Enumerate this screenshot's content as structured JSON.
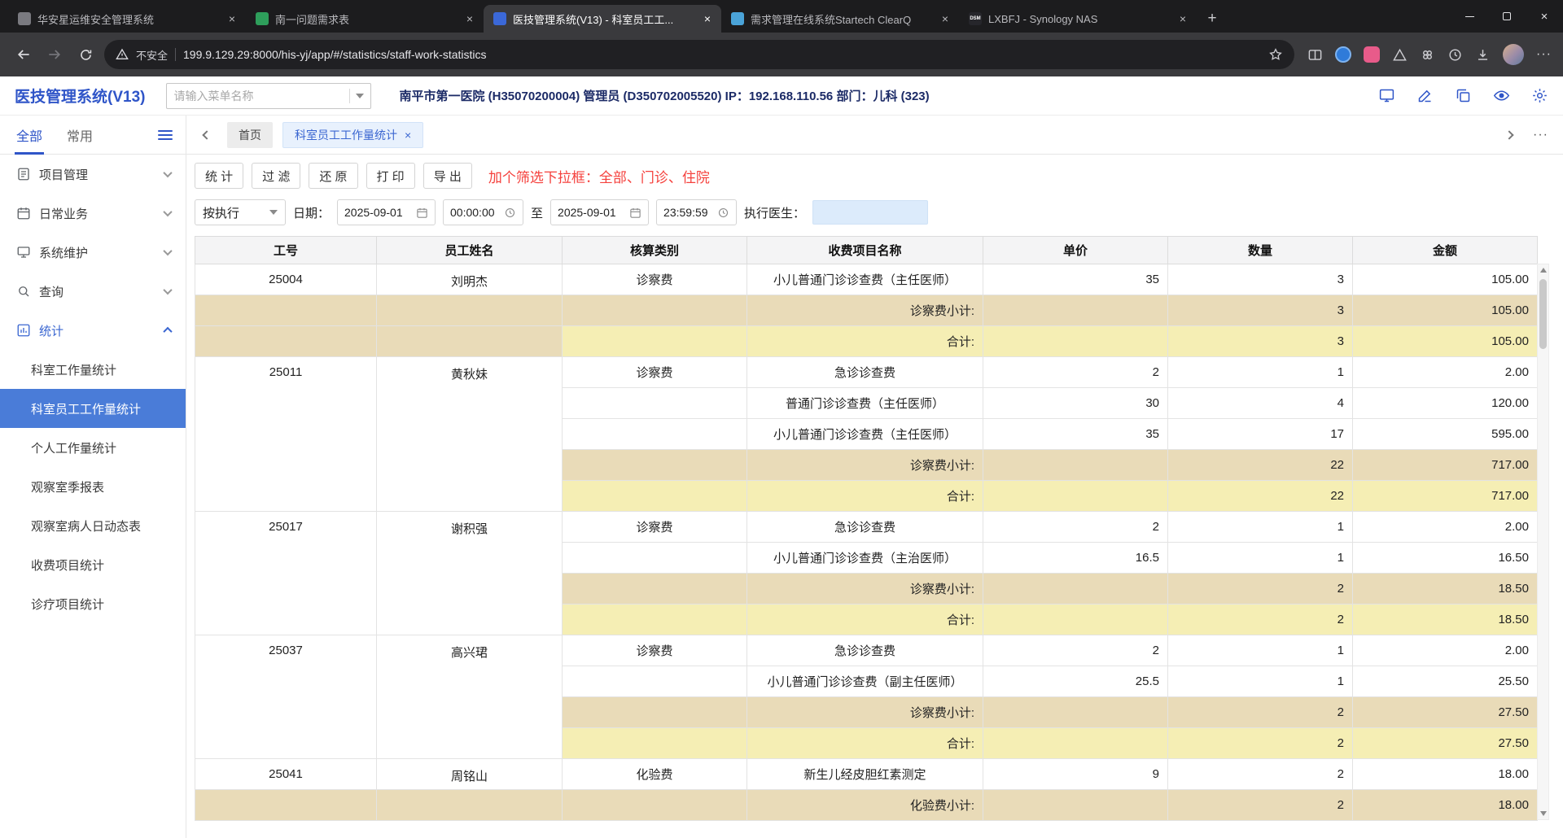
{
  "browser": {
    "tabs": [
      {
        "title": "华安星运维安全管理系统"
      },
      {
        "title": "南一问题需求表"
      },
      {
        "title": "医技管理系统(V13) - 科室员工工...",
        "active": true
      },
      {
        "title": "需求管理在线系统Startech ClearQ"
      },
      {
        "title": "LXBFJ - Synology NAS",
        "favicon_text": "DSM"
      }
    ],
    "security_label": "不安全",
    "url": "199.9.129.29:8000/his-yj/app/#/statistics/staff-work-statistics"
  },
  "header": {
    "app_title": "医技管理系统(V13)",
    "menu_search_placeholder": "请输入菜单名称",
    "user_info": "南平市第一医院 (H35070200004) 管理员 (D350702005520) IP：192.168.110.56 部门：儿科 (323)"
  },
  "tabstrip": {
    "filter_all": "全部",
    "filter_common": "常用",
    "home_tab": "首页",
    "active_tab": "科室员工工作量统计"
  },
  "sidebar": {
    "sections": [
      {
        "label": "项目管理"
      },
      {
        "label": "日常业务"
      },
      {
        "label": "系统维护"
      },
      {
        "label": "查询"
      },
      {
        "label": "统计",
        "expanded": true
      }
    ],
    "stat_children": [
      {
        "label": "科室工作量统计"
      },
      {
        "label": "科室员工工作量统计",
        "active": true
      },
      {
        "label": "个人工作量统计"
      },
      {
        "label": "观察室季报表"
      },
      {
        "label": "观察室病人日动态表"
      },
      {
        "label": "收费项目统计"
      },
      {
        "label": "诊疗项目统计"
      }
    ]
  },
  "toolbar": {
    "buttons": [
      "统 计",
      "过 滤",
      "还 原",
      "打 印",
      "导 出"
    ],
    "annotation": "加个筛选下拉框：全部、门诊、住院"
  },
  "filters": {
    "mode": "按执行",
    "date_label": "日期：",
    "date_from": "2025-09-01",
    "time_from": "00:00:00",
    "to_label": "至",
    "date_to": "2025-09-01",
    "time_to": "23:59:59",
    "doctor_label": "执行医生："
  },
  "table": {
    "columns": [
      "工号",
      "员工姓名",
      "核算类别",
      "收费项目名称",
      "单价",
      "数量",
      "金额"
    ],
    "rows": [
      {
        "type": "group",
        "span": 1,
        "id": "25004",
        "name": "刘明杰",
        "cat": "诊察费",
        "item": "小儿普通门诊诊查费（主任医师）",
        "price": "35",
        "qty": "3",
        "amount": "105.00"
      },
      {
        "type": "subfull",
        "item": "诊察费小计:",
        "qty": "3",
        "amount": "105.00"
      },
      {
        "type": "totfull",
        "item": "合计:",
        "qty": "3",
        "amount": "105.00"
      },
      {
        "type": "group",
        "span": 5,
        "id": "25011",
        "name": "黄秋妹",
        "cat": "诊察费",
        "item": "急诊诊查费",
        "price": "2",
        "qty": "1",
        "amount": "2.00"
      },
      {
        "type": "cont",
        "item": "普通门诊诊查费（主任医师）",
        "price": "30",
        "qty": "4",
        "amount": "120.00"
      },
      {
        "type": "cont",
        "item": "小儿普通门诊诊查费（主任医师）",
        "price": "35",
        "qty": "17",
        "amount": "595.00"
      },
      {
        "type": "subpart",
        "item": "诊察费小计:",
        "qty": "22",
        "amount": "717.00"
      },
      {
        "type": "totpart",
        "item": "合计:",
        "qty": "22",
        "amount": "717.00"
      },
      {
        "type": "group",
        "span": 4,
        "id": "25017",
        "name": "谢积强",
        "cat": "诊察费",
        "item": "急诊诊查费",
        "price": "2",
        "qty": "1",
        "amount": "2.00"
      },
      {
        "type": "cont",
        "item": "小儿普通门诊诊查费（主治医师）",
        "price": "16.5",
        "qty": "1",
        "amount": "16.50"
      },
      {
        "type": "subpart",
        "item": "诊察费小计:",
        "qty": "2",
        "amount": "18.50"
      },
      {
        "type": "totpart",
        "item": "合计:",
        "qty": "2",
        "amount": "18.50"
      },
      {
        "type": "group",
        "span": 4,
        "id": "25037",
        "name": "高兴珺",
        "cat": "诊察费",
        "item": "急诊诊查费",
        "price": "2",
        "qty": "1",
        "amount": "2.00"
      },
      {
        "type": "cont",
        "item": "小儿普通门诊诊查费（副主任医师）",
        "price": "25.5",
        "qty": "1",
        "amount": "25.50"
      },
      {
        "type": "subpart",
        "item": "诊察费小计:",
        "qty": "2",
        "amount": "27.50"
      },
      {
        "type": "totpart",
        "item": "合计:",
        "qty": "2",
        "amount": "27.50"
      },
      {
        "type": "group",
        "span": 1,
        "id": "25041",
        "name": "周铭山",
        "cat": "化验费",
        "item": "新生儿经皮胆红素测定",
        "price": "9",
        "qty": "2",
        "amount": "18.00"
      },
      {
        "type": "subfull",
        "item": "化验费小计:",
        "qty": "2",
        "amount": "18.00"
      }
    ]
  },
  "icons": {
    "close": "×",
    "plus": "+",
    "more": "···"
  }
}
